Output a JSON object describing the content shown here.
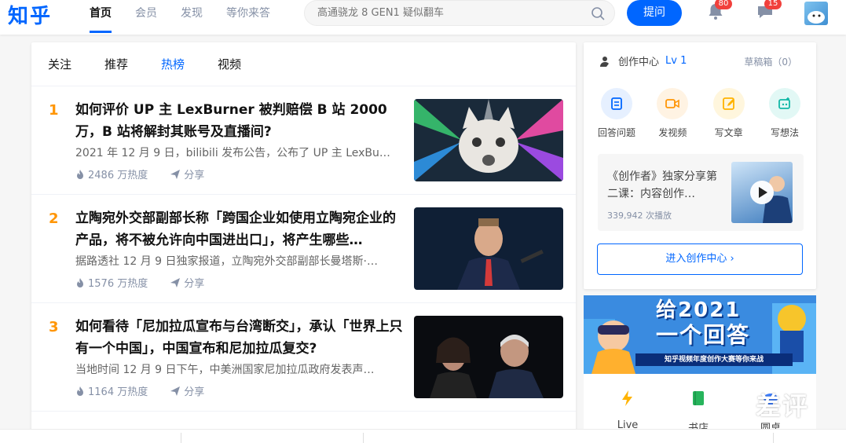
{
  "logo": "知乎",
  "nav": [
    {
      "label": "首页",
      "active": true
    },
    {
      "label": "会员"
    },
    {
      "label": "发现"
    },
    {
      "label": "等你来答"
    }
  ],
  "search": {
    "placeholder": "高通骁龙 8 GEN1 疑似翻车"
  },
  "ask_button": "提问",
  "notifications": {
    "count": "80"
  },
  "messages": {
    "count": "15"
  },
  "feed_tabs": [
    {
      "label": "关注"
    },
    {
      "label": "推荐"
    },
    {
      "label": "热榜",
      "active": true
    },
    {
      "label": "视频"
    }
  ],
  "hot_list": [
    {
      "rank": "1",
      "title": "如何评价 UP 主 LexBurner 被判赔偿 B 站 2000 万，B 站将解封其账号及直播间?",
      "excerpt": "2021 年 12 月 9 日，bilibili 发布公告，公布了 UP 主 LexBu…",
      "heat": "2486 万热度",
      "share": "分享"
    },
    {
      "rank": "2",
      "title": "立陶宛外交部副部长称「跨国企业如使用立陶宛企业的产品，将不被允许向中国进出口」，将产生哪些…",
      "excerpt": "据路透社 12 月 9 日独家报道，立陶宛外交部副部长曼塔斯·…",
      "heat": "1576 万热度",
      "share": "分享"
    },
    {
      "rank": "3",
      "title": "如何看待「尼加拉瓜宣布与台湾断交」，承认「世界上只有一个中国」，中国宣布和尼加拉瓜复交?",
      "excerpt": "当地时间 12 月 9 日下午，中美洲国家尼加拉瓜政府发表声…",
      "heat": "1164 万热度",
      "share": "分享"
    }
  ],
  "creator": {
    "title": "创作中心",
    "level": "Lv 1",
    "draft": "草稿箱（0）",
    "actions": [
      {
        "label": "回答问题",
        "icon": "answer-icon",
        "color": "#0066ff",
        "bg": "#e6f0ff"
      },
      {
        "label": "发视频",
        "icon": "video-icon",
        "color": "#ff9607",
        "bg": "#fff3e3"
      },
      {
        "label": "写文章",
        "icon": "article-icon",
        "color": "#ffb300",
        "bg": "#fff6dd"
      },
      {
        "label": "写想法",
        "icon": "idea-icon",
        "color": "#12b7a6",
        "bg": "#e2f8f5"
      }
    ],
    "promo": {
      "title": "《创作者》独家分享第二课：内容创作…",
      "views": "339,942 次播放"
    },
    "enter_button": "进入创作中心 ›"
  },
  "banner": {
    "line1": "给2021",
    "line2": "一个回答",
    "strip": "知乎视频年度创作大赛等你来战"
  },
  "quick_links": [
    {
      "label": "Live"
    },
    {
      "label": "书店"
    },
    {
      "label": "圆桌"
    }
  ],
  "watermark": "差评"
}
